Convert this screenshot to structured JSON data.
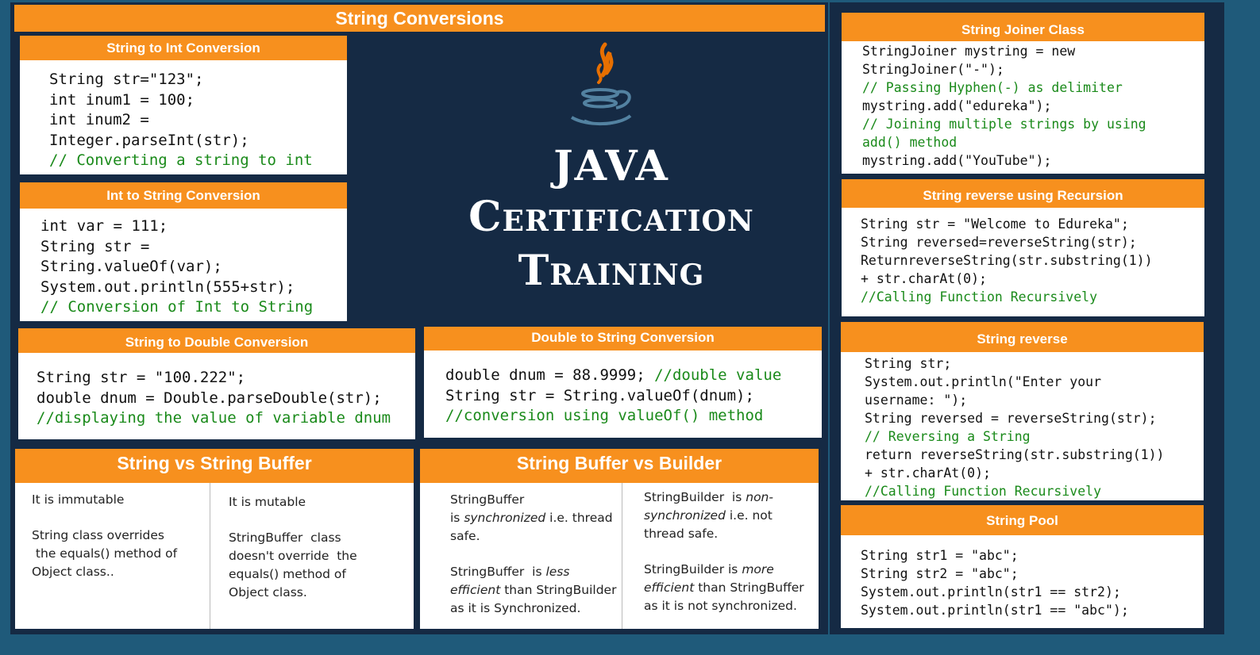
{
  "main_title": "String Conversions",
  "center_title": {
    "line1": "JAVA",
    "line2": "Certification",
    "line3": "Training"
  },
  "s2i": {
    "title": "String to Int Conversion",
    "lines": [
      "String str=\"123\";",
      "int inum1 = 100;",
      "int inum2 =",
      "Integer.parseInt(str);"
    ],
    "comment": "// Converting a string to int"
  },
  "i2s": {
    "title": "Int to String Conversion",
    "lines": [
      "int var = 111;",
      "String str =",
      "String.valueOf(var);",
      "System.out.println(555+str);"
    ],
    "comment": "// Conversion of Int to String"
  },
  "s2d": {
    "title": "String to Double Conversion",
    "lines": [
      "String str = \"100.222\";",
      "double dnum = Double.parseDouble(str);"
    ],
    "comment": "//displaying the value of variable dnum"
  },
  "d2s": {
    "title": "Double to String Conversion",
    "line1_code": "double dnum = 88.9999; ",
    "line1_comment": "//double value",
    "line2": "String str = String.valueOf(dnum);",
    "comment": "//conversion using valueOf() method"
  },
  "svsb": {
    "title": "String vs String Buffer",
    "left": [
      "It is immutable",
      "String class overrides",
      " the equals() method of",
      "Object class.."
    ],
    "right": [
      "It is mutable",
      "StringBuffer  class",
      "doesn't override  the",
      "equals() method of",
      "Object class."
    ]
  },
  "bvsb": {
    "title": "String Buffer vs Builder",
    "left": {
      "l1": "StringBuffer",
      "l2a": "is ",
      "l2b": "synchronized",
      "l2c": " i.e. thread",
      "l3": "safe.",
      "l4a": "StringBuffer  is ",
      "l4b": "less",
      "l5a": "efficient",
      "l5b": " than StringBuilder",
      "l6": "as it is Synchronized."
    },
    "right": {
      "l1a": "StringBuilder  is ",
      "l1b": "non-",
      "l2a": "synchronized",
      "l2b": " i.e. not",
      "l3": "thread safe.",
      "l4a": "StringBuilder is ",
      "l4b": "more",
      "l5a": "efficient",
      "l5b": " than StringBuffer",
      "l6": "as it is not synchronized."
    }
  },
  "joiner": {
    "title": "String Joiner Class",
    "l1": "StringJoiner mystring = new",
    "l2": "StringJoiner(\"-\");",
    "c1": "// Passing Hyphen(-) as delimiter",
    "l3": "mystring.add(\"edureka\");",
    "c2": "// Joining multiple strings by using",
    "c3": "add() method",
    "l4": "mystring.add(\"YouTube\");"
  },
  "recursion": {
    "title": "String reverse using Recursion",
    "lines": [
      "String str = \"Welcome to Edureka\";",
      "String reversed=reverseString(str);",
      "ReturnreverseString(str.substring(1))",
      "+ str.charAt(0);"
    ],
    "comment": "//Calling Function Recursively"
  },
  "reverse": {
    "title": "String reverse",
    "l1": "String str;",
    "l2": "System.out.println(\"Enter your",
    "l3": "username: \");",
    "l4": "String reversed = reverseString(str);",
    "c1": "// Reversing a String",
    "l5": "return reverseString(str.substring(1))",
    "l6": "+ str.charAt(0);",
    "c2": "//Calling Function Recursively"
  },
  "pool": {
    "title": "String Pool",
    "lines": [
      "String str1 = \"abc\";",
      "String str2 = \"abc\";",
      "System.out.println(str1 == str2);",
      "System.out.println(str1 == \"abc\");"
    ]
  },
  "colors": {
    "orange": "#f7901e",
    "navy": "#152a44",
    "comment_green": "#1a8a1a",
    "java_blue": "#5382a1",
    "java_orange": "#e76f00"
  }
}
